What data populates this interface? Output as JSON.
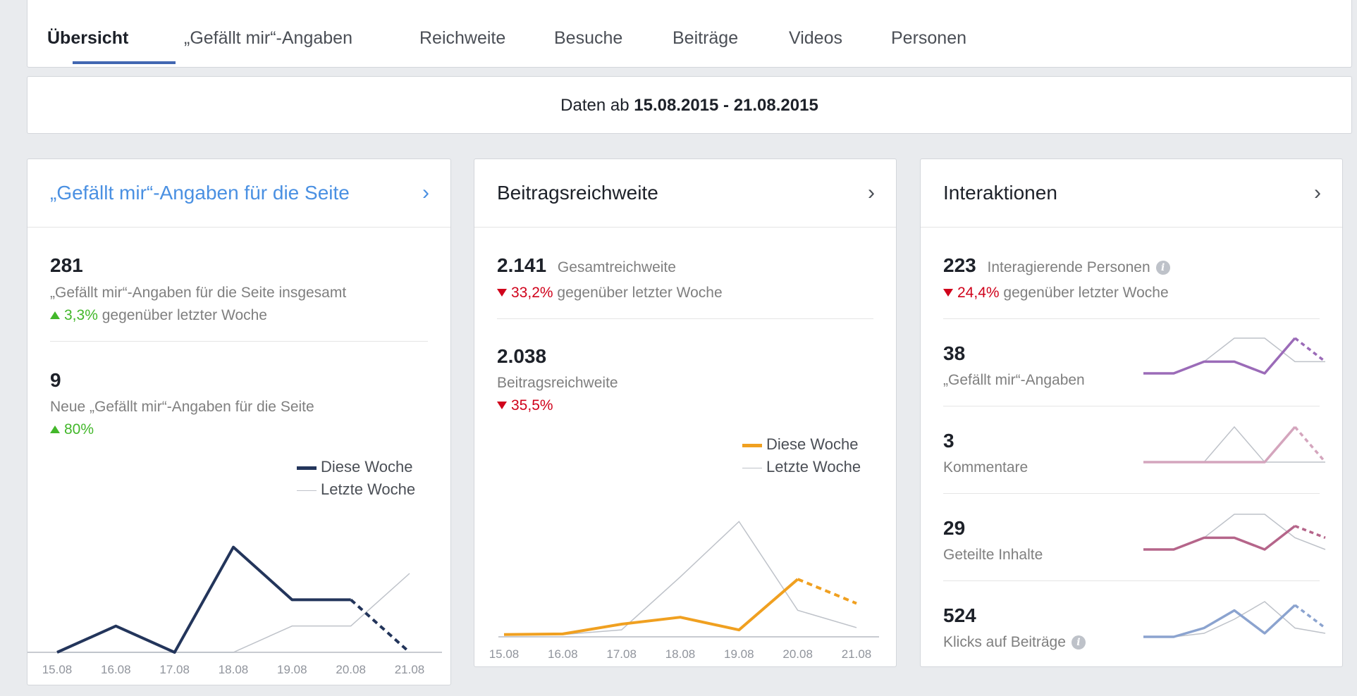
{
  "tabs": [
    {
      "label": "Übersicht",
      "active": true
    },
    {
      "label": "„Gefällt mir“-Angaben"
    },
    {
      "label": "Reichweite"
    },
    {
      "label": "Besuche"
    },
    {
      "label": "Beiträge"
    },
    {
      "label": "Videos"
    },
    {
      "label": "Personen"
    }
  ],
  "date_range": {
    "prefix": "Daten ab",
    "range": "15.08.2015 - 21.08.2015"
  },
  "colors": {
    "accent": "#4267b2",
    "likes_line": "#23355b",
    "reach_line": "#f0a020",
    "up": "#42b72a",
    "down": "#d0021b",
    "last_week": "#bec2c9"
  },
  "likes_card": {
    "title": "„Gefällt mir“-Angaben für die Seite",
    "total_value": "281",
    "total_label": "„Gefällt mir“-Angaben für die Seite insgesamt",
    "total_change": "3,3%",
    "total_change_text": "gegenüber letzter Woche",
    "new_value": "9",
    "new_label": "Neue „Gefällt mir“-Angaben für die Seite",
    "new_change": "80%",
    "legend_this": "Diese Woche",
    "legend_last": "Letzte Woche"
  },
  "reach_card": {
    "title": "Beitragsreichweite",
    "total_value": "2.141",
    "total_label": "Gesamtreichweite",
    "total_change": "33,2%",
    "total_change_text": "gegenüber letzter Woche",
    "post_value": "2.038",
    "post_label": "Beitragsreichweite",
    "post_change": "35,5%",
    "legend_this": "Diese Woche",
    "legend_last": "Letzte Woche"
  },
  "interactions_card": {
    "title": "Interaktionen",
    "total_value": "223",
    "total_label": "Interagierende Personen",
    "total_change": "24,4%",
    "total_change_text": "gegenüber letzter Woche",
    "rows": [
      {
        "value": "38",
        "label": "„Gefällt mir“-Angaben",
        "color": "#9b6bb8",
        "this_week": [
          5,
          5,
          6,
          6,
          5,
          8,
          6
        ],
        "last_week": [
          5,
          5,
          6,
          8,
          8,
          6,
          6
        ]
      },
      {
        "value": "3",
        "label": "Kommentare",
        "color": "#d4a5bd",
        "this_week": [
          0,
          0,
          0,
          0,
          0,
          1,
          0
        ],
        "last_week": [
          0,
          0,
          0,
          1,
          0,
          0,
          0
        ]
      },
      {
        "value": "29",
        "label": "Geteilte Inhalte",
        "color": "#b5658a",
        "this_week": [
          4,
          4,
          5,
          5,
          4,
          6,
          5
        ],
        "last_week": [
          4,
          4,
          5,
          7,
          7,
          5,
          4
        ]
      },
      {
        "value": "524",
        "label": "Klicks auf Beiträge",
        "color": "#8ba3cf",
        "this_week": [
          70,
          70,
          75,
          85,
          72,
          88,
          75
        ],
        "last_week": [
          70,
          70,
          72,
          80,
          90,
          75,
          72
        ]
      }
    ]
  },
  "chart_data": [
    {
      "type": "line",
      "x": [
        "15.08",
        "16.08",
        "17.08",
        "18.08",
        "19.08",
        "20.08",
        "21.08"
      ],
      "series": [
        {
          "name": "Diese Woche",
          "values": [
            0,
            1,
            0,
            4,
            2,
            2,
            0
          ]
        },
        {
          "name": "Letzte Woche",
          "values": [
            0,
            0,
            0,
            0,
            1,
            1,
            3
          ]
        }
      ],
      "ylim": [
        0,
        4.5
      ],
      "grid": false
    },
    {
      "type": "line",
      "x": [
        "15.08",
        "16.08",
        "17.08",
        "18.08",
        "19.08",
        "20.08",
        "21.08"
      ],
      "series": [
        {
          "name": "Diese Woche",
          "values": [
            20,
            25,
            110,
            170,
            60,
            500,
            290
          ]
        },
        {
          "name": "Letzte Woche",
          "values": [
            20,
            20,
            60,
            520,
            1000,
            230,
            80
          ]
        }
      ],
      "ylim": [
        0,
        1100
      ],
      "grid": false
    }
  ]
}
